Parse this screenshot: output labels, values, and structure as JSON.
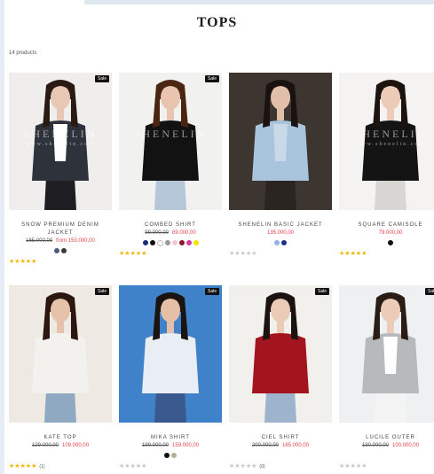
{
  "page": {
    "title": "TOPS",
    "count": "14 products"
  },
  "products": [
    {
      "name_lines": [
        "SNOW PREMIUM DENIM",
        "JACKET"
      ],
      "old_price": "165.000,00",
      "new_price": "from 150.000,00",
      "sale": "Sale",
      "swatches": [
        "#4e5d7a",
        "#3a3a3a"
      ],
      "rating": 5,
      "review_count": "",
      "watermark": [
        "SHENELIN",
        "www.shenelin.com"
      ],
      "colors": {
        "bg": "#efeeec",
        "top": "#2e333b",
        "inner": "#ffffff",
        "hair": "#2a1a14",
        "skin": "#e8c8b4",
        "bottom": "#1e1e22"
      }
    },
    {
      "name_lines": [
        "COMBED SHIRT"
      ],
      "old_price": "99.000,00",
      "new_price": "89.000,00",
      "sale": "Sale",
      "swatches": [
        "#1a2b7a",
        "#111111",
        "#ffffff",
        "#9a9a9a",
        "#f2c9cf",
        "#8a1525",
        "#d23aa5",
        "#f5e400"
      ],
      "rating": 5,
      "review_count": "",
      "watermark": [
        "SHENELIN",
        ""
      ],
      "colors": {
        "bg": "#f1f1ef",
        "top": "#121212",
        "inner": "#121212",
        "hair": "#4a2512",
        "skin": "#e9c4ae",
        "bottom": "#b4c6d8"
      }
    },
    {
      "name_lines": [
        "SHENELIN BASIC JACKET"
      ],
      "old_price": "",
      "new_price": "135.000,00",
      "sale": "",
      "swatches": [
        "#8fb6e8",
        "#1c2f8a"
      ],
      "rating": 0,
      "review_count": "",
      "watermark": [
        "",
        ""
      ],
      "colors": {
        "bg": "#3d3530",
        "top": "#a9c4dd",
        "inner": "#c9d9e8",
        "hair": "#1a1210",
        "skin": "#e2bfa8",
        "bottom": "#2b2522"
      }
    },
    {
      "name_lines": [
        "SQUARE CAMISOLE"
      ],
      "old_price": "",
      "new_price": "79.000,00",
      "sale": "",
      "swatches": [
        "#111111"
      ],
      "rating": 5,
      "review_count": "",
      "watermark": [
        "SHENELIN",
        "www.shenelin.com"
      ],
      "colors": {
        "bg": "#f4f3f1",
        "top": "#141414",
        "inner": "#141414",
        "hair": "#1c130f",
        "skin": "#ecccb9",
        "bottom": "#d8d6d2"
      }
    },
    {
      "name_lines": [
        "KATE TOP"
      ],
      "old_price": "129.000,00",
      "new_price": "109.000,00",
      "sale": "Sale",
      "swatches": [],
      "rating": 5,
      "review_count": "(1)",
      "watermark": [
        "",
        ""
      ],
      "colors": {
        "bg": "#efe9e4",
        "top": "#f3f1ee",
        "inner": "#f3f1ee",
        "hair": "#2a1810",
        "skin": "#e6c2ab",
        "bottom": "#8fa9c3"
      }
    },
    {
      "name_lines": [
        "MIKA SHIRT"
      ],
      "old_price": "199.000,00",
      "new_price": "159.000,00",
      "sale": "Sale",
      "swatches": [
        "#111111",
        "#b9ae98"
      ],
      "rating": 0,
      "review_count": "",
      "watermark": [
        "",
        ""
      ],
      "colors": {
        "bg": "#3f82c9",
        "top": "#e9eef4",
        "inner": "#e9eef4",
        "hair": "#1a1310",
        "skin": "#e5c0a7",
        "bottom": "#3a5a8f"
      }
    },
    {
      "name_lines": [
        "CIEL SHIRT"
      ],
      "old_price": "200.000,00",
      "new_price": "165.000,00",
      "sale": "Sale",
      "swatches": [],
      "rating": 0,
      "review_count": "(0)",
      "watermark": [
        "",
        ""
      ],
      "colors": {
        "bg": "#f2f0ec",
        "top": "#a3151e",
        "inner": "#a3151e",
        "hair": "#1a1310",
        "skin": "#ebcab6",
        "bottom": "#9db4cc"
      }
    },
    {
      "name_lines": [
        "LUCILE OUTER"
      ],
      "old_price": "130.000,00",
      "new_price": "100.000,00",
      "sale": "Sale",
      "swatches": [],
      "rating": 0,
      "review_count": "",
      "watermark": [
        "",
        ""
      ],
      "colors": {
        "bg": "#eef0f2",
        "top": "#b7b9bc",
        "inner": "#ffffff",
        "hair": "#2a1d16",
        "skin": "#ecccb8",
        "bottom": "#f4f4f4"
      }
    }
  ]
}
